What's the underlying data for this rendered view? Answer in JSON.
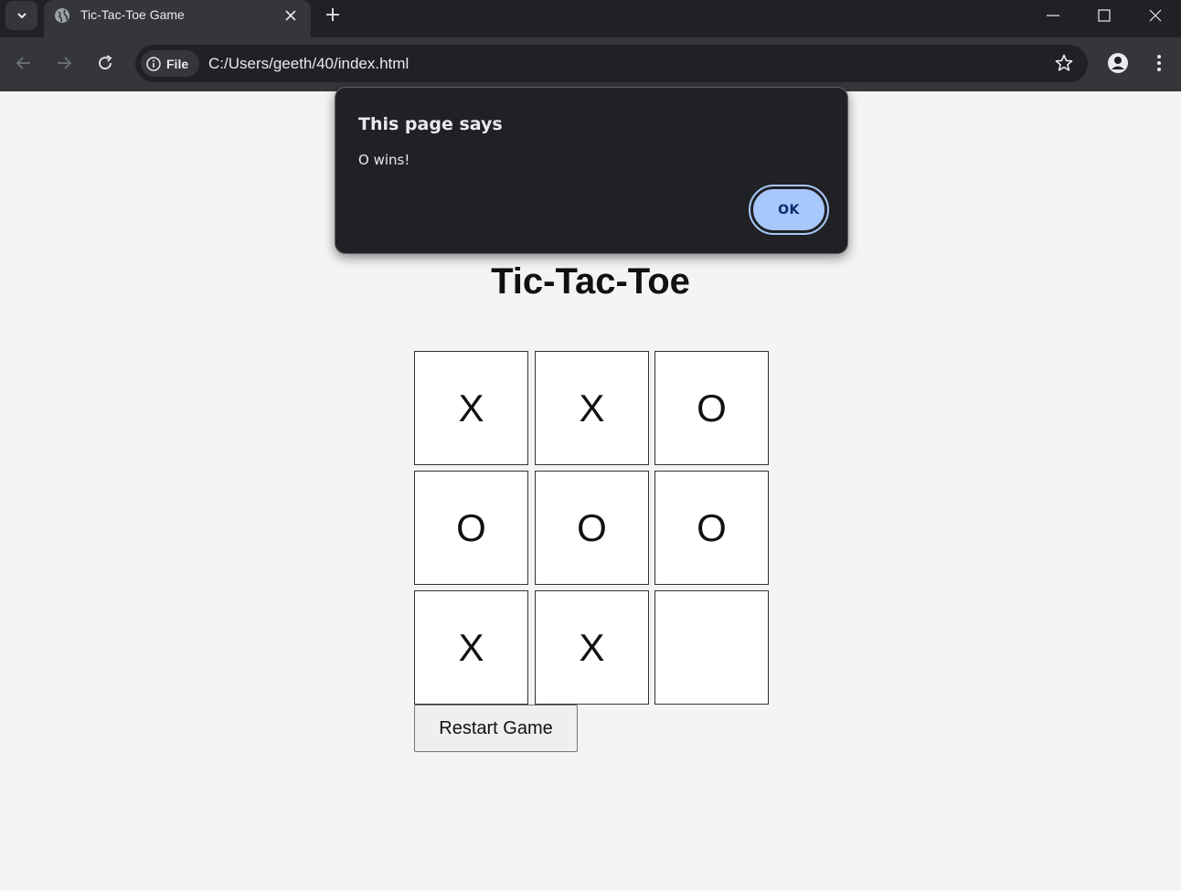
{
  "browser": {
    "tab_title": "Tic-Tac-Toe Game",
    "chip_label": "File",
    "url": "C:/Users/geeth/40/index.html"
  },
  "page": {
    "title": "Tic-Tac-Toe",
    "board": [
      "X",
      "X",
      "O",
      "O",
      "O",
      "O",
      "X",
      "X",
      ""
    ],
    "restart_label": "Restart Game"
  },
  "dialog": {
    "title": "This page says",
    "message": "O wins!",
    "ok_label": "OK"
  },
  "colors": {
    "page_background": "#f4f4f4",
    "dialog_background": "#202124",
    "ok_button": "#a8c7fa"
  }
}
